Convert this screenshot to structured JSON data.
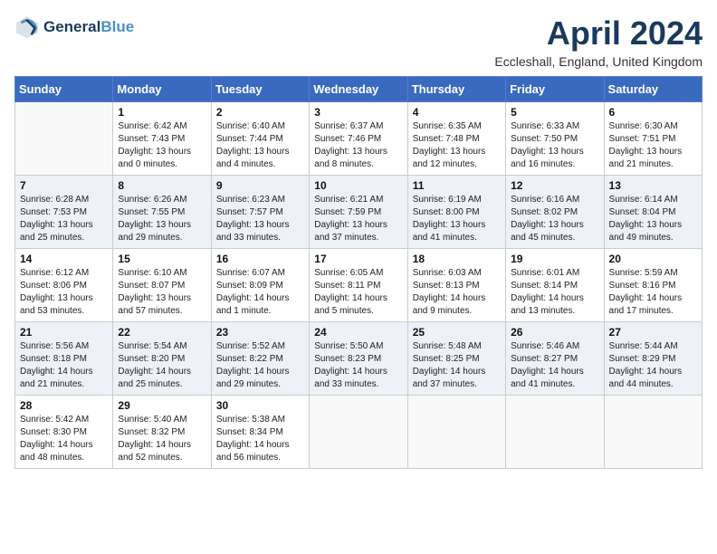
{
  "header": {
    "logo_line1": "General",
    "logo_line2": "Blue",
    "month_year": "April 2024",
    "location": "Eccleshall, England, United Kingdom"
  },
  "days_of_week": [
    "Sunday",
    "Monday",
    "Tuesday",
    "Wednesday",
    "Thursday",
    "Friday",
    "Saturday"
  ],
  "weeks": [
    [
      {
        "day": "",
        "info": ""
      },
      {
        "day": "1",
        "info": "Sunrise: 6:42 AM\nSunset: 7:43 PM\nDaylight: 13 hours\nand 0 minutes."
      },
      {
        "day": "2",
        "info": "Sunrise: 6:40 AM\nSunset: 7:44 PM\nDaylight: 13 hours\nand 4 minutes."
      },
      {
        "day": "3",
        "info": "Sunrise: 6:37 AM\nSunset: 7:46 PM\nDaylight: 13 hours\nand 8 minutes."
      },
      {
        "day": "4",
        "info": "Sunrise: 6:35 AM\nSunset: 7:48 PM\nDaylight: 13 hours\nand 12 minutes."
      },
      {
        "day": "5",
        "info": "Sunrise: 6:33 AM\nSunset: 7:50 PM\nDaylight: 13 hours\nand 16 minutes."
      },
      {
        "day": "6",
        "info": "Sunrise: 6:30 AM\nSunset: 7:51 PM\nDaylight: 13 hours\nand 21 minutes."
      }
    ],
    [
      {
        "day": "7",
        "info": "Sunrise: 6:28 AM\nSunset: 7:53 PM\nDaylight: 13 hours\nand 25 minutes."
      },
      {
        "day": "8",
        "info": "Sunrise: 6:26 AM\nSunset: 7:55 PM\nDaylight: 13 hours\nand 29 minutes."
      },
      {
        "day": "9",
        "info": "Sunrise: 6:23 AM\nSunset: 7:57 PM\nDaylight: 13 hours\nand 33 minutes."
      },
      {
        "day": "10",
        "info": "Sunrise: 6:21 AM\nSunset: 7:59 PM\nDaylight: 13 hours\nand 37 minutes."
      },
      {
        "day": "11",
        "info": "Sunrise: 6:19 AM\nSunset: 8:00 PM\nDaylight: 13 hours\nand 41 minutes."
      },
      {
        "day": "12",
        "info": "Sunrise: 6:16 AM\nSunset: 8:02 PM\nDaylight: 13 hours\nand 45 minutes."
      },
      {
        "day": "13",
        "info": "Sunrise: 6:14 AM\nSunset: 8:04 PM\nDaylight: 13 hours\nand 49 minutes."
      }
    ],
    [
      {
        "day": "14",
        "info": "Sunrise: 6:12 AM\nSunset: 8:06 PM\nDaylight: 13 hours\nand 53 minutes."
      },
      {
        "day": "15",
        "info": "Sunrise: 6:10 AM\nSunset: 8:07 PM\nDaylight: 13 hours\nand 57 minutes."
      },
      {
        "day": "16",
        "info": "Sunrise: 6:07 AM\nSunset: 8:09 PM\nDaylight: 14 hours\nand 1 minute."
      },
      {
        "day": "17",
        "info": "Sunrise: 6:05 AM\nSunset: 8:11 PM\nDaylight: 14 hours\nand 5 minutes."
      },
      {
        "day": "18",
        "info": "Sunrise: 6:03 AM\nSunset: 8:13 PM\nDaylight: 14 hours\nand 9 minutes."
      },
      {
        "day": "19",
        "info": "Sunrise: 6:01 AM\nSunset: 8:14 PM\nDaylight: 14 hours\nand 13 minutes."
      },
      {
        "day": "20",
        "info": "Sunrise: 5:59 AM\nSunset: 8:16 PM\nDaylight: 14 hours\nand 17 minutes."
      }
    ],
    [
      {
        "day": "21",
        "info": "Sunrise: 5:56 AM\nSunset: 8:18 PM\nDaylight: 14 hours\nand 21 minutes."
      },
      {
        "day": "22",
        "info": "Sunrise: 5:54 AM\nSunset: 8:20 PM\nDaylight: 14 hours\nand 25 minutes."
      },
      {
        "day": "23",
        "info": "Sunrise: 5:52 AM\nSunset: 8:22 PM\nDaylight: 14 hours\nand 29 minutes."
      },
      {
        "day": "24",
        "info": "Sunrise: 5:50 AM\nSunset: 8:23 PM\nDaylight: 14 hours\nand 33 minutes."
      },
      {
        "day": "25",
        "info": "Sunrise: 5:48 AM\nSunset: 8:25 PM\nDaylight: 14 hours\nand 37 minutes."
      },
      {
        "day": "26",
        "info": "Sunrise: 5:46 AM\nSunset: 8:27 PM\nDaylight: 14 hours\nand 41 minutes."
      },
      {
        "day": "27",
        "info": "Sunrise: 5:44 AM\nSunset: 8:29 PM\nDaylight: 14 hours\nand 44 minutes."
      }
    ],
    [
      {
        "day": "28",
        "info": "Sunrise: 5:42 AM\nSunset: 8:30 PM\nDaylight: 14 hours\nand 48 minutes."
      },
      {
        "day": "29",
        "info": "Sunrise: 5:40 AM\nSunset: 8:32 PM\nDaylight: 14 hours\nand 52 minutes."
      },
      {
        "day": "30",
        "info": "Sunrise: 5:38 AM\nSunset: 8:34 PM\nDaylight: 14 hours\nand 56 minutes."
      },
      {
        "day": "",
        "info": ""
      },
      {
        "day": "",
        "info": ""
      },
      {
        "day": "",
        "info": ""
      },
      {
        "day": "",
        "info": ""
      }
    ]
  ]
}
